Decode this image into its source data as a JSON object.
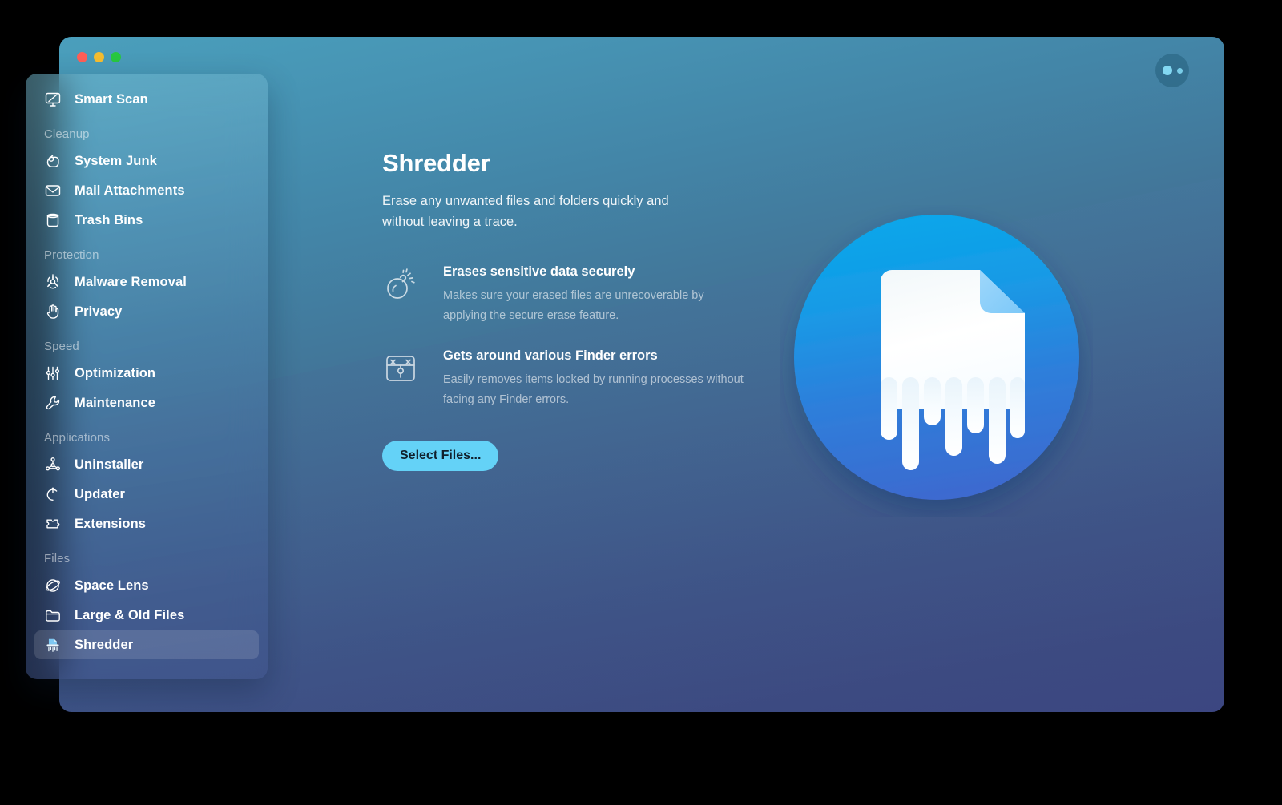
{
  "window": {
    "traffic_lights": [
      {
        "name": "close",
        "color": "#ff5f57"
      },
      {
        "name": "minimize",
        "color": "#f5bd30"
      },
      {
        "name": "zoom",
        "color": "#28c840"
      }
    ],
    "menu_button_label": "",
    "accent_color": "#64d2f7",
    "background_top_color": "#4a9fbc",
    "background_bottom_color": "#3b4480"
  },
  "sidebar": {
    "groups": [
      {
        "title": null,
        "items": [
          {
            "label": "Smart Scan",
            "icon": "monitor-scan-icon",
            "selected": false
          }
        ]
      },
      {
        "title": "Cleanup",
        "items": [
          {
            "label": "System Junk",
            "icon": "brush-icon",
            "selected": false
          },
          {
            "label": "Mail Attachments",
            "icon": "envelope-icon",
            "selected": false
          },
          {
            "label": "Trash Bins",
            "icon": "trash-bin-icon",
            "selected": false
          }
        ]
      },
      {
        "title": "Protection",
        "items": [
          {
            "label": "Malware Removal",
            "icon": "biohazard-icon",
            "selected": false
          },
          {
            "label": "Privacy",
            "icon": "hand-icon",
            "selected": false
          }
        ]
      },
      {
        "title": "Speed",
        "items": [
          {
            "label": "Optimization",
            "icon": "sliders-icon",
            "selected": false
          },
          {
            "label": "Maintenance",
            "icon": "wrench-icon",
            "selected": false
          }
        ]
      },
      {
        "title": "Applications",
        "items": [
          {
            "label": "Uninstaller",
            "icon": "molecule-icon",
            "selected": false
          },
          {
            "label": "Updater",
            "icon": "refresh-arrow-icon",
            "selected": false
          },
          {
            "label": "Extensions",
            "icon": "puzzle-piece-icon",
            "selected": false
          }
        ]
      },
      {
        "title": "Files",
        "items": [
          {
            "label": "Space Lens",
            "icon": "planet-icon",
            "selected": false
          },
          {
            "label": "Large & Old Files",
            "icon": "folder-icon",
            "selected": false
          },
          {
            "label": "Shredder",
            "icon": "shredder-icon",
            "selected": true
          }
        ]
      }
    ]
  },
  "main": {
    "title": "Shredder",
    "subtitle": "Erase any unwanted files and folders quickly and without leaving a trace.",
    "features": [
      {
        "icon": "bomb-icon",
        "title": "Erases sensitive data securely",
        "description": "Makes sure your erased files are unrecoverable by applying the secure erase feature."
      },
      {
        "icon": "locked-chest-icon",
        "title": "Gets around various Finder errors",
        "description": "Easily removes items locked by running processes without facing any Finder errors."
      }
    ],
    "primary_button_label": "Select Files...",
    "illustration": "shredded-document-icon"
  }
}
